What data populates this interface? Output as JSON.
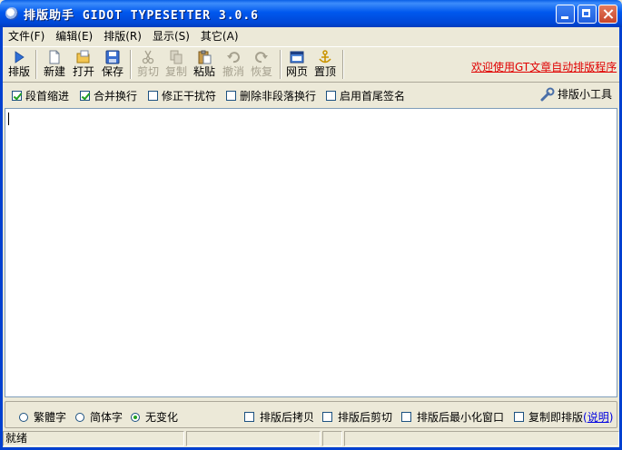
{
  "window": {
    "title": "排版助手 GIDOT TYPESETTER 3.0.6"
  },
  "menu": [
    "文件(F)",
    "编辑(E)",
    "排版(R)",
    "显示(S)",
    "其它(A)"
  ],
  "toolbar": {
    "typeset": "排版",
    "new": "新建",
    "open": "打开",
    "save": "保存",
    "cut": "剪切",
    "copy": "复制",
    "paste": "粘贴",
    "undo": "撤消",
    "redo": "恢复",
    "webpage": "网页",
    "pin": "置顶",
    "welcome": "欢迎使用GT文章自动排版程序"
  },
  "options": {
    "indent": {
      "label": "段首缩进",
      "checked": true
    },
    "merge": {
      "label": "合并换行",
      "checked": true
    },
    "fix": {
      "label": "修正干扰符",
      "checked": false
    },
    "delete_breaks": {
      "label": "删除非段落换行",
      "checked": false
    },
    "signature": {
      "label": "启用首尾签名",
      "checked": false
    },
    "tools": "排版小工具"
  },
  "editor": {
    "content": ""
  },
  "bottom": {
    "traditional": "繁體字",
    "simplified": "简体字",
    "nochange": "无变化",
    "selected": "nochange",
    "copy_after": "排版后拷贝",
    "cut_after": "排版后剪切",
    "minimize_after": "排版后最小化窗口",
    "copy_typeset": "复制即排版",
    "help_open": "(",
    "help_link": "说明",
    "help_close": ")"
  },
  "status": {
    "text": "就绪"
  },
  "colors": {
    "titlebar": "#0058ee",
    "accent_red": "#e00000",
    "link_blue": "#0000e0",
    "face": "#ece9d8"
  }
}
